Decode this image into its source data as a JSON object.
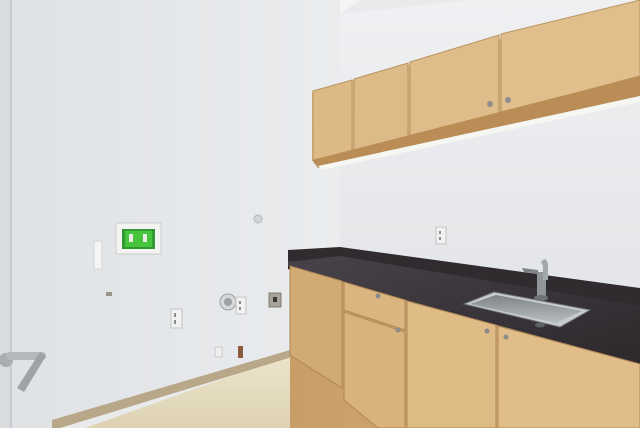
{
  "scene": {
    "kind": "photo-laundry-room",
    "colors": {
      "left_wall": "#e6e8ea",
      "back_wall": "#eceef0",
      "ceiling": "#f2f3f4",
      "cabinet_wood": "#d9b583",
      "cabinet_shadow": "#b88f5a",
      "countertop": "#3a3538",
      "sink_steel": "#9aa0a4",
      "floor": "#e6dcc0",
      "baseboard": "#b9a98a",
      "washer_box_screen": "#3cc23a"
    },
    "icons": [
      "door-lever-icon",
      "faucet-icon",
      "electrical-outlet-icon",
      "dryer-vent-icon",
      "washer-valve-box-icon"
    ]
  }
}
